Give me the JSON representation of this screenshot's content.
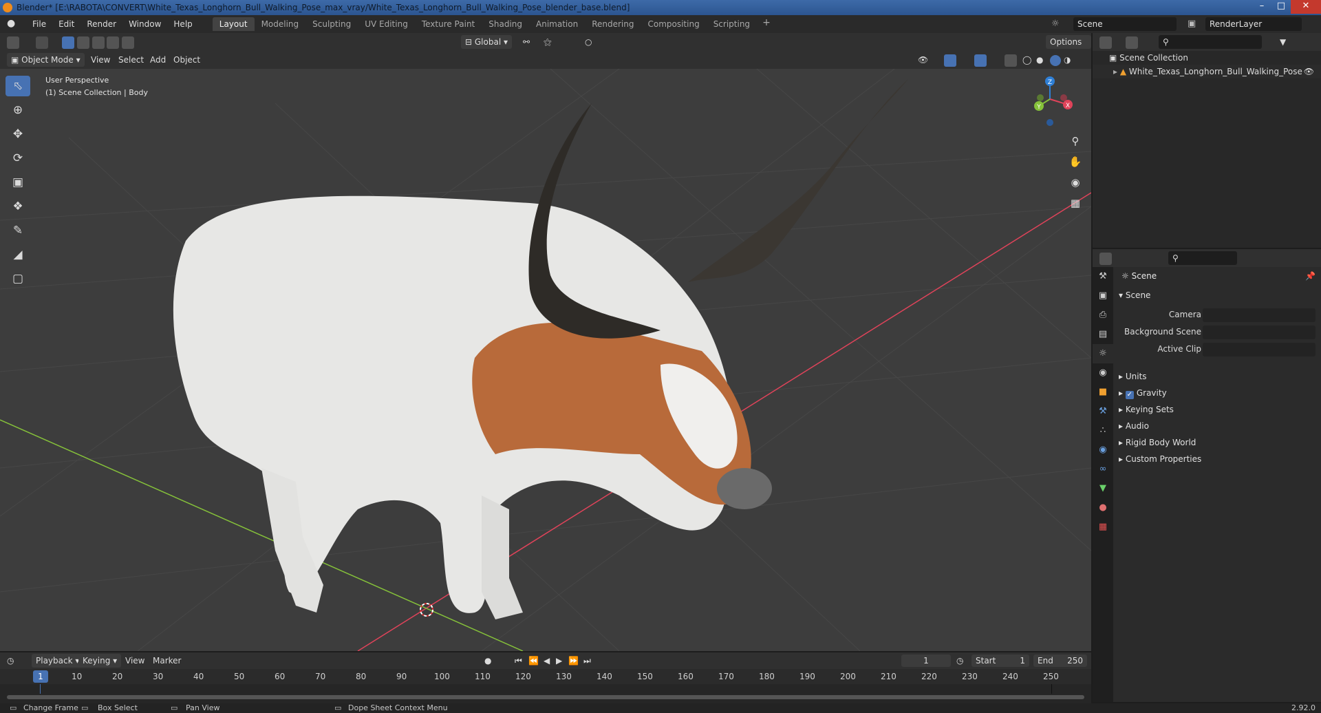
{
  "window": {
    "title": "Blender* [E:\\RABOTA\\CONVERT\\White_Texas_Longhorn_Bull_Walking_Pose_max_vray/White_Texas_Longhorn_Bull_Walking_Pose_blender_base.blend]",
    "controls": [
      "–",
      "□",
      "✕"
    ]
  },
  "menu": [
    "File",
    "Edit",
    "Render",
    "Window",
    "Help"
  ],
  "workspaces": [
    "Layout",
    "Modeling",
    "Sculpting",
    "UV Editing",
    "Texture Paint",
    "Shading",
    "Animation",
    "Rendering",
    "Compositing",
    "Scripting"
  ],
  "workspace_add": "+",
  "scene_name": "Scene",
  "render_layer": "RenderLayer",
  "viewport_header": {
    "transform_orientation": "Global",
    "options": "Options",
    "mode": "Object Mode",
    "menus": [
      "View",
      "Select",
      "Add",
      "Object"
    ]
  },
  "viewport": {
    "perspective_label": "User Perspective",
    "collection_label": "(1) Scene Collection | Body",
    "gizmo_axes": {
      "x": "X",
      "y": "Y",
      "z": "Z"
    }
  },
  "outliner": {
    "root": "Scene Collection",
    "object": "White_Texas_Longhorn_Bull_Walking_Pose"
  },
  "properties": {
    "title": "Scene",
    "panel": "Scene",
    "fields": [
      {
        "label": "Camera"
      },
      {
        "label": "Background Scene"
      },
      {
        "label": "Active Clip"
      }
    ],
    "subpanels": [
      "Units",
      "Gravity",
      "Keying Sets",
      "Audio",
      "Rigid Body World",
      "Custom Properties"
    ],
    "gravity_enabled": true
  },
  "timeline": {
    "menus": [
      "Playback",
      "Keying",
      "View",
      "Marker"
    ],
    "current_frame": "1",
    "start_label": "Start",
    "start_value": "1",
    "end_label": "End",
    "end_value": "250",
    "ruler": [
      "10",
      "20",
      "30",
      "40",
      "50",
      "60",
      "70",
      "80",
      "90",
      "100",
      "110",
      "120",
      "130",
      "140",
      "150",
      "160",
      "170",
      "180",
      "190",
      "200",
      "210",
      "220",
      "230",
      "240",
      "250"
    ],
    "ruler_marker": "1"
  },
  "statusbar": {
    "items": [
      "Change Frame",
      "Box Select",
      "Pan View",
      "Dope Sheet Context Menu"
    ],
    "version": "2.92.0"
  },
  "colors": {
    "accent": "#4772b3",
    "axis_x": "#e0435a",
    "axis_y": "#86c23a",
    "axis_z": "#2e7fd6",
    "viewport_bg": "#3d3d3d"
  }
}
